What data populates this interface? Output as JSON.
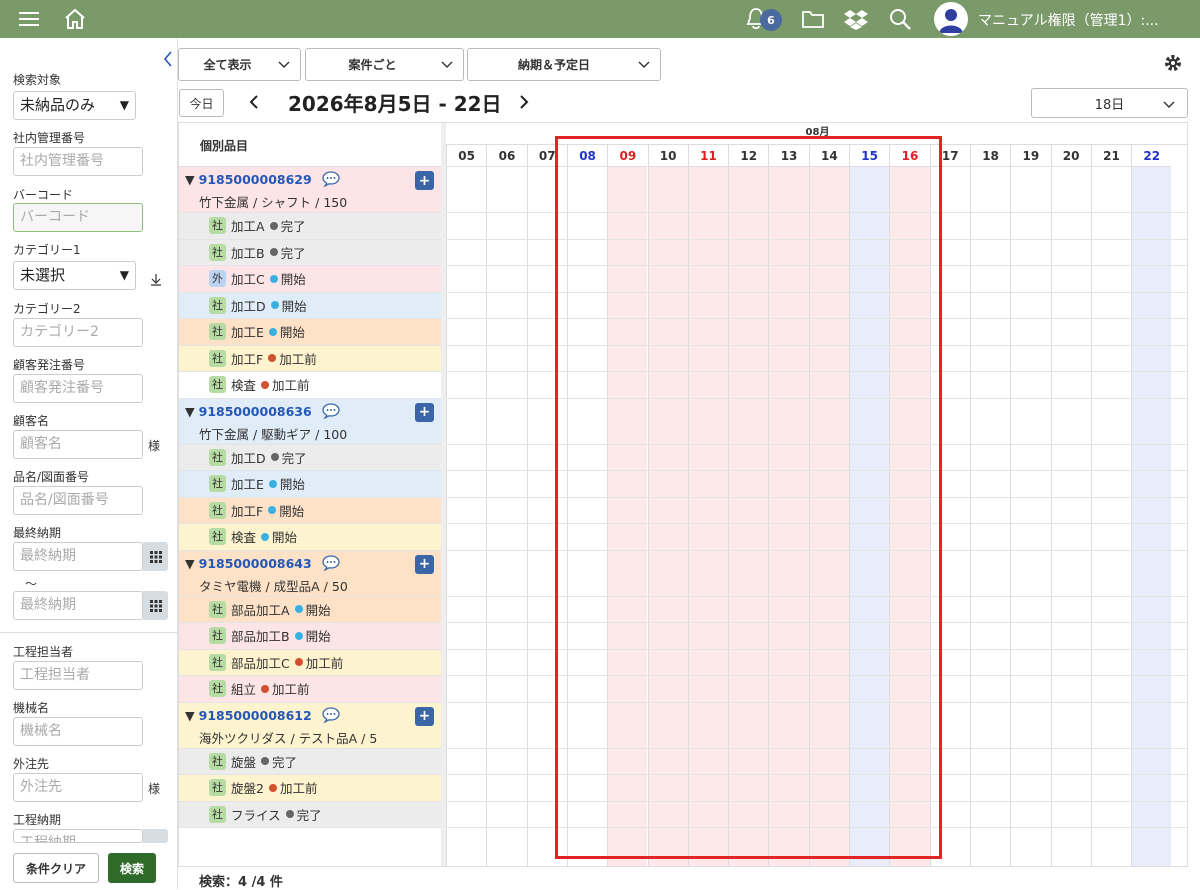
{
  "header": {
    "notification_count": "6",
    "user_name": "マニュアル権限（管理1）:..."
  },
  "sidebar": {
    "target_label": "検索対象",
    "target_value": "未納品のみ",
    "internal_no_label": "社内管理番号",
    "internal_no_placeholder": "社内管理番号",
    "barcode_label": "バーコード",
    "barcode_placeholder": "バーコード",
    "category1_label": "カテゴリー1",
    "category1_value": "未選択",
    "category2_label": "カテゴリー2",
    "category2_placeholder": "カテゴリー2",
    "customer_order_label": "顧客発注番号",
    "customer_order_placeholder": "顧客発注番号",
    "customer_name_label": "顧客名",
    "customer_name_placeholder": "顧客名",
    "sama": "様",
    "part_label": "品名/図面番号",
    "part_placeholder": "品名/図面番号",
    "final_due_label": "最終納期",
    "final_due_placeholder": "最終納期",
    "tilde": "〜",
    "process_owner_label": "工程担当者",
    "process_owner_placeholder": "工程担当者",
    "machine_label": "機械名",
    "machine_placeholder": "機械名",
    "outsource_label": "外注先",
    "outsource_placeholder": "外注先",
    "process_due_label": "工程納期",
    "process_due_placeholder": "工程納期",
    "clear_button": "条件クリア",
    "search_button": "検索"
  },
  "toolbar": {
    "filter1": "全て表示",
    "filter2": "案件ごと",
    "filter3": "納期＆予定日",
    "today_button": "今日",
    "date_range": "2026年8月5日 - 22日",
    "range_select": "18日"
  },
  "grid": {
    "left_header": "個別品目",
    "month_label": "08月",
    "days": [
      {
        "label": "05",
        "color": "#333",
        "bg": "#fff"
      },
      {
        "label": "06",
        "color": "#333",
        "bg": "#fff"
      },
      {
        "label": "07",
        "color": "#333",
        "bg": "#fff"
      },
      {
        "label": "08",
        "color": "#2233cc",
        "bg": "#fff"
      },
      {
        "label": "09",
        "color": "#e02020",
        "bg": "#fde8ea"
      },
      {
        "label": "10",
        "color": "#333",
        "bg": "#fde8ea"
      },
      {
        "label": "11",
        "color": "#e02020",
        "bg": "#fde8ea"
      },
      {
        "label": "12",
        "color": "#333",
        "bg": "#fde8ea"
      },
      {
        "label": "13",
        "color": "#333",
        "bg": "#fde8ea"
      },
      {
        "label": "14",
        "color": "#333",
        "bg": "#fde8ea"
      },
      {
        "label": "15",
        "color": "#2233cc",
        "bg": "#e8ecfb"
      },
      {
        "label": "16",
        "color": "#e02020",
        "bg": "#fde8ea"
      },
      {
        "label": "17",
        "color": "#333",
        "bg": "#fff"
      },
      {
        "label": "18",
        "color": "#333",
        "bg": "#fff"
      },
      {
        "label": "19",
        "color": "#333",
        "bg": "#fff"
      },
      {
        "label": "20",
        "color": "#333",
        "bg": "#fff"
      },
      {
        "label": "21",
        "color": "#333",
        "bg": "#fff"
      },
      {
        "label": "22",
        "color": "#2233cc",
        "bg": "#e8ecfb"
      }
    ],
    "rows": [
      {
        "type": "parent",
        "num": "9185000008629",
        "sub": "竹下金属 / シャフト / 150",
        "bg": "#fde4e6"
      },
      {
        "type": "child",
        "tag": "社",
        "name": "加工A",
        "status": "完了",
        "dot": "#666",
        "bg": "#ececec"
      },
      {
        "type": "child",
        "tag": "社",
        "name": "加工B",
        "status": "完了",
        "dot": "#666",
        "bg": "#ececec"
      },
      {
        "type": "child",
        "tag": "外",
        "name": "加工C",
        "status": "開始",
        "dot": "#3ab0e0",
        "bg": "#fde4e6"
      },
      {
        "type": "child",
        "tag": "社",
        "name": "加工D",
        "status": "開始",
        "dot": "#3ab0e0",
        "bg": "#e0ecf8"
      },
      {
        "type": "child",
        "tag": "社",
        "name": "加工E",
        "status": "開始",
        "dot": "#3ab0e0",
        "bg": "#fde2c8"
      },
      {
        "type": "child",
        "tag": "社",
        "name": "加工F",
        "status": "加工前",
        "dot": "#d05030",
        "bg": "#fdf3cf"
      },
      {
        "type": "child",
        "tag": "社",
        "name": "検査",
        "status": "加工前",
        "dot": "#d05030",
        "bg": "#ffffff"
      },
      {
        "type": "parent",
        "num": "9185000008636",
        "sub": "竹下金属 / 駆動ギア / 100",
        "bg": "#e0ecf8"
      },
      {
        "type": "child",
        "tag": "社",
        "name": "加工D",
        "status": "完了",
        "dot": "#666",
        "bg": "#ececec"
      },
      {
        "type": "child",
        "tag": "社",
        "name": "加工E",
        "status": "開始",
        "dot": "#3ab0e0",
        "bg": "#e0ecf8"
      },
      {
        "type": "child",
        "tag": "社",
        "name": "加工F",
        "status": "開始",
        "dot": "#3ab0e0",
        "bg": "#fde2c8"
      },
      {
        "type": "child",
        "tag": "社",
        "name": "検査",
        "status": "開始",
        "dot": "#3ab0e0",
        "bg": "#fdf3cf"
      },
      {
        "type": "parent",
        "num": "9185000008643",
        "sub": "タミヤ電機 / 成型品A / 50",
        "bg": "#fde2c8"
      },
      {
        "type": "child",
        "tag": "社",
        "name": "部品加工A",
        "status": "開始",
        "dot": "#3ab0e0",
        "bg": "#fde2c8"
      },
      {
        "type": "child",
        "tag": "社",
        "name": "部品加工B",
        "status": "開始",
        "dot": "#3ab0e0",
        "bg": "#fde4e6"
      },
      {
        "type": "child",
        "tag": "社",
        "name": "部品加工C",
        "status": "加工前",
        "dot": "#d05030",
        "bg": "#fdf3cf"
      },
      {
        "type": "child",
        "tag": "社",
        "name": "組立",
        "status": "加工前",
        "dot": "#d05030",
        "bg": "#fde4e6"
      },
      {
        "type": "parent",
        "num": "9185000008612",
        "sub": "海外ツクリダス / テスト品A / 5",
        "bg": "#fdf3cf"
      },
      {
        "type": "child",
        "tag": "社",
        "name": "旋盤",
        "status": "完了",
        "dot": "#666",
        "bg": "#ececec"
      },
      {
        "type": "child",
        "tag": "社",
        "name": "旋盤2",
        "status": "加工前",
        "dot": "#d05030",
        "bg": "#fdf3cf"
      },
      {
        "type": "child",
        "tag": "社",
        "name": "フライス",
        "status": "完了",
        "dot": "#666",
        "bg": "#ececec"
      }
    ]
  },
  "footer": {
    "count": "検索：4 /4 件"
  }
}
